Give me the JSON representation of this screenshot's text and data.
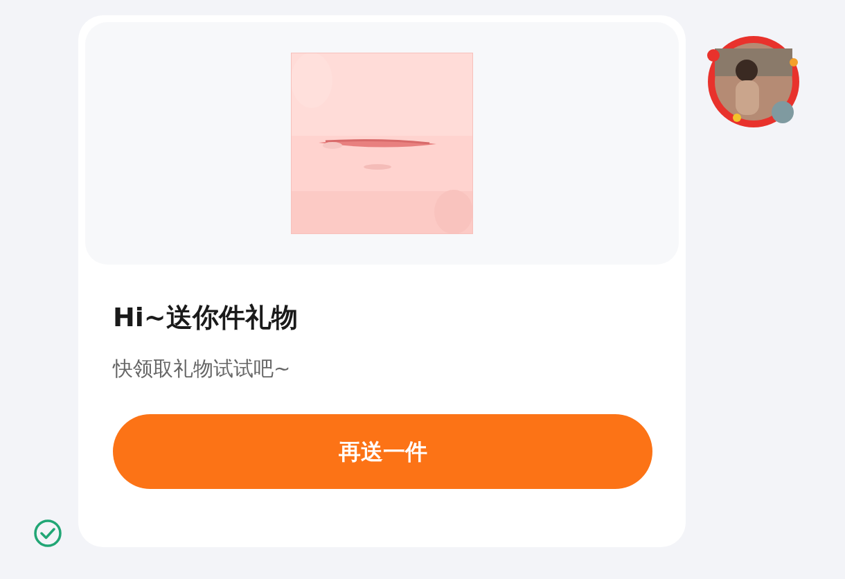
{
  "gift_card": {
    "title": "Hi~送你件礼物",
    "subtitle": "快领取礼物试试吧~",
    "button": "再送一件"
  },
  "message_status": {
    "sent": true
  }
}
